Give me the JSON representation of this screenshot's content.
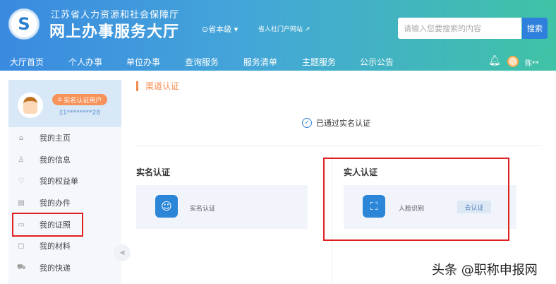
{
  "header": {
    "org": "江苏省人力资源和社会保障厅",
    "title": "网上办事服务大厅",
    "level": "省本级",
    "portal": "省人社门户网站",
    "search_placeholder": "请输入您要搜索的内容",
    "search_button": "搜索",
    "user": "陈**"
  },
  "nav": [
    "大厅首页",
    "个人办事",
    "单位办事",
    "查询服务",
    "服务清单",
    "主题服务",
    "公示公告"
  ],
  "profile": {
    "badge": "实名认证用户",
    "phone": "1********28"
  },
  "menu": [
    {
      "label": "我的主页",
      "icon": "home-icon"
    },
    {
      "label": "我的信息",
      "icon": "user-icon"
    },
    {
      "label": "我的权益单",
      "icon": "heart-shield-icon"
    },
    {
      "label": "我的办件",
      "icon": "document-icon"
    },
    {
      "label": "我的证照",
      "icon": "id-card-icon"
    },
    {
      "label": "我的材料",
      "icon": "folder-icon"
    },
    {
      "label": "我的快递",
      "icon": "truck-icon"
    }
  ],
  "main": {
    "title": "渠道认证",
    "passed": "已通过实名认证",
    "left": {
      "heading": "实名认证",
      "item": "实名认证"
    },
    "right": {
      "heading": "实人认证",
      "item": "人脸识别",
      "button": "去认证"
    }
  },
  "watermark": "头条 @职称申报网"
}
